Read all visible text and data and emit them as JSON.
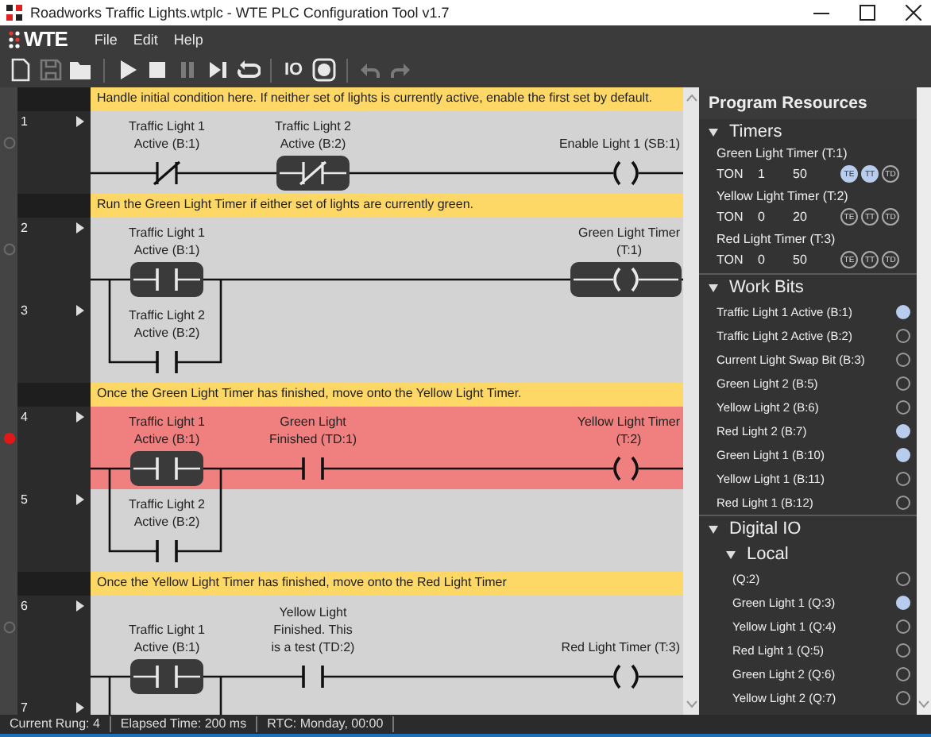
{
  "window": {
    "title": "Roadworks Traffic Lights.wtplc - WTE PLC Configuration Tool v1.7"
  },
  "menu": {
    "logo": "WTE",
    "items": [
      "File",
      "Edit",
      "Help"
    ]
  },
  "toolbar": [
    [
      {
        "disabled": false
      },
      {
        "disabled": true
      },
      {
        "disabled": false
      }
    ],
    [
      {
        "disabled": false
      },
      {
        "disabled": false
      },
      {
        "disabled": true
      },
      {
        "disabled": false
      },
      {
        "disabled": false
      }
    ],
    [
      {
        "label": "IO",
        "disabled": false
      },
      {
        "disabled": false
      }
    ],
    [
      {
        "disabled": true
      },
      {
        "disabled": true
      }
    ]
  ],
  "rungs": [
    {
      "comment": "Handle initial condition here. If neither set of lights is currently active, enable the first set by default.",
      "breakpoint": false,
      "rows": [
        {
          "number": "1",
          "active": false
        }
      ],
      "contacts": [
        {
          "kind": "nc",
          "label": "Traffic Light 1\nActive (B:1)",
          "energized": false
        },
        {
          "kind": "nc",
          "label": "Traffic Light 2\nActive (B:2)",
          "energized": true
        }
      ],
      "coil": {
        "label": "Enable Light 1 (SB:1)",
        "energized": false
      }
    },
    {
      "comment": "Run the Green Light Timer if either set of lights are currently green.",
      "breakpoint": false,
      "rows": [
        {
          "number": "2",
          "active": false
        },
        {
          "number": "3",
          "active": false
        }
      ],
      "contacts": [
        {
          "kind": "no",
          "label": "Traffic Light 1\nActive (B:1)",
          "energized": true
        }
      ],
      "branch": {
        "kind": "no",
        "label": "Traffic Light 2\nActive (B:2)",
        "energized": false
      },
      "coil": {
        "label": "Green Light Timer\n(T:1)",
        "energized": true
      }
    },
    {
      "comment": "Once the Green Light Timer has finished, move onto the Yellow Light Timer.",
      "breakpoint": true,
      "rows": [
        {
          "number": "4",
          "active": true
        },
        {
          "number": "5",
          "active": false
        }
      ],
      "contacts": [
        {
          "kind": "no",
          "label": "Traffic Light 1\nActive (B:1)",
          "energized": true
        },
        {
          "kind": "no",
          "label": "Green Light\nFinished (TD:1)",
          "energized": false
        }
      ],
      "branch": {
        "kind": "no",
        "label": "Traffic Light 2\nActive (B:2)",
        "energized": false
      },
      "coil": {
        "label": "Yellow Light Timer\n(T:2)",
        "energized": false
      }
    },
    {
      "comment": "Once the Yellow Light Timer has finished, move onto the Red Light Timer",
      "breakpoint": false,
      "rows": [
        {
          "number": "6",
          "active": false
        },
        {
          "number": "7",
          "active": false
        }
      ],
      "contacts": [
        {
          "kind": "no",
          "label": "Traffic Light 1\nActive (B:1)",
          "energized": true
        },
        {
          "kind": "no",
          "label": "Yellow Light\nFinished. This\nis a test (TD:2)",
          "energized": false
        }
      ],
      "branch_offscreen": true,
      "coil": {
        "label": "Red Light Timer (T:3)",
        "energized": false
      }
    }
  ],
  "resources": {
    "title": "Program Resources",
    "timers": {
      "title": "Timers",
      "expanded": true,
      "items": [
        {
          "name": "Green Light Timer (T:1)",
          "type": "TON",
          "accumulated": "1",
          "preset": "50",
          "bits": [
            {
              "label": "TE",
              "on": true
            },
            {
              "label": "TT",
              "on": true
            },
            {
              "label": "TD",
              "on": false
            }
          ]
        },
        {
          "name": "Yellow Light Timer (T:2)",
          "type": "TON",
          "accumulated": "0",
          "preset": "20",
          "bits": [
            {
              "label": "TE",
              "on": false
            },
            {
              "label": "TT",
              "on": false
            },
            {
              "label": "TD",
              "on": false
            }
          ]
        },
        {
          "name": "Red Light Timer (T:3)",
          "type": "TON",
          "accumulated": "0",
          "preset": "50",
          "bits": [
            {
              "label": "TE",
              "on": false
            },
            {
              "label": "TT",
              "on": false
            },
            {
              "label": "TD",
              "on": false
            }
          ]
        }
      ]
    },
    "work_bits": {
      "title": "Work Bits",
      "expanded": true,
      "items": [
        {
          "name": "Traffic Light 1 Active (B:1)",
          "on": true
        },
        {
          "name": "Traffic Light 2 Active (B:2)",
          "on": false
        },
        {
          "name": "Current Light Swap Bit (B:3)",
          "on": false
        },
        {
          "name": "Green Light 2 (B:5)",
          "on": false
        },
        {
          "name": "Yellow Light 2 (B:6)",
          "on": false
        },
        {
          "name": "Red Light 2 (B:7)",
          "on": true
        },
        {
          "name": "Green Light 1 (B:10)",
          "on": true
        },
        {
          "name": "Yellow Light 1 (B:11)",
          "on": false
        },
        {
          "name": "Red Light 1 (B:12)",
          "on": false
        }
      ]
    },
    "digital_io": {
      "title": "Digital IO",
      "expanded": true,
      "children": [
        {
          "title": "Local",
          "expanded": true,
          "items": [
            {
              "name": "(Q:2)",
              "on": false
            },
            {
              "name": "Green Light 1 (Q:3)",
              "on": true
            },
            {
              "name": "Yellow Light 1 (Q:4)",
              "on": false
            },
            {
              "name": "Red Light 1 (Q:5)",
              "on": false
            },
            {
              "name": "Green Light 2 (Q:6)",
              "on": false
            },
            {
              "name": "Yellow Light 2 (Q:7)",
              "on": false
            }
          ]
        }
      ]
    }
  },
  "status_bar": [
    "Current Rung: 4",
    "Elapsed Time: 200 ms",
    "RTC: Monday, 00:00"
  ]
}
